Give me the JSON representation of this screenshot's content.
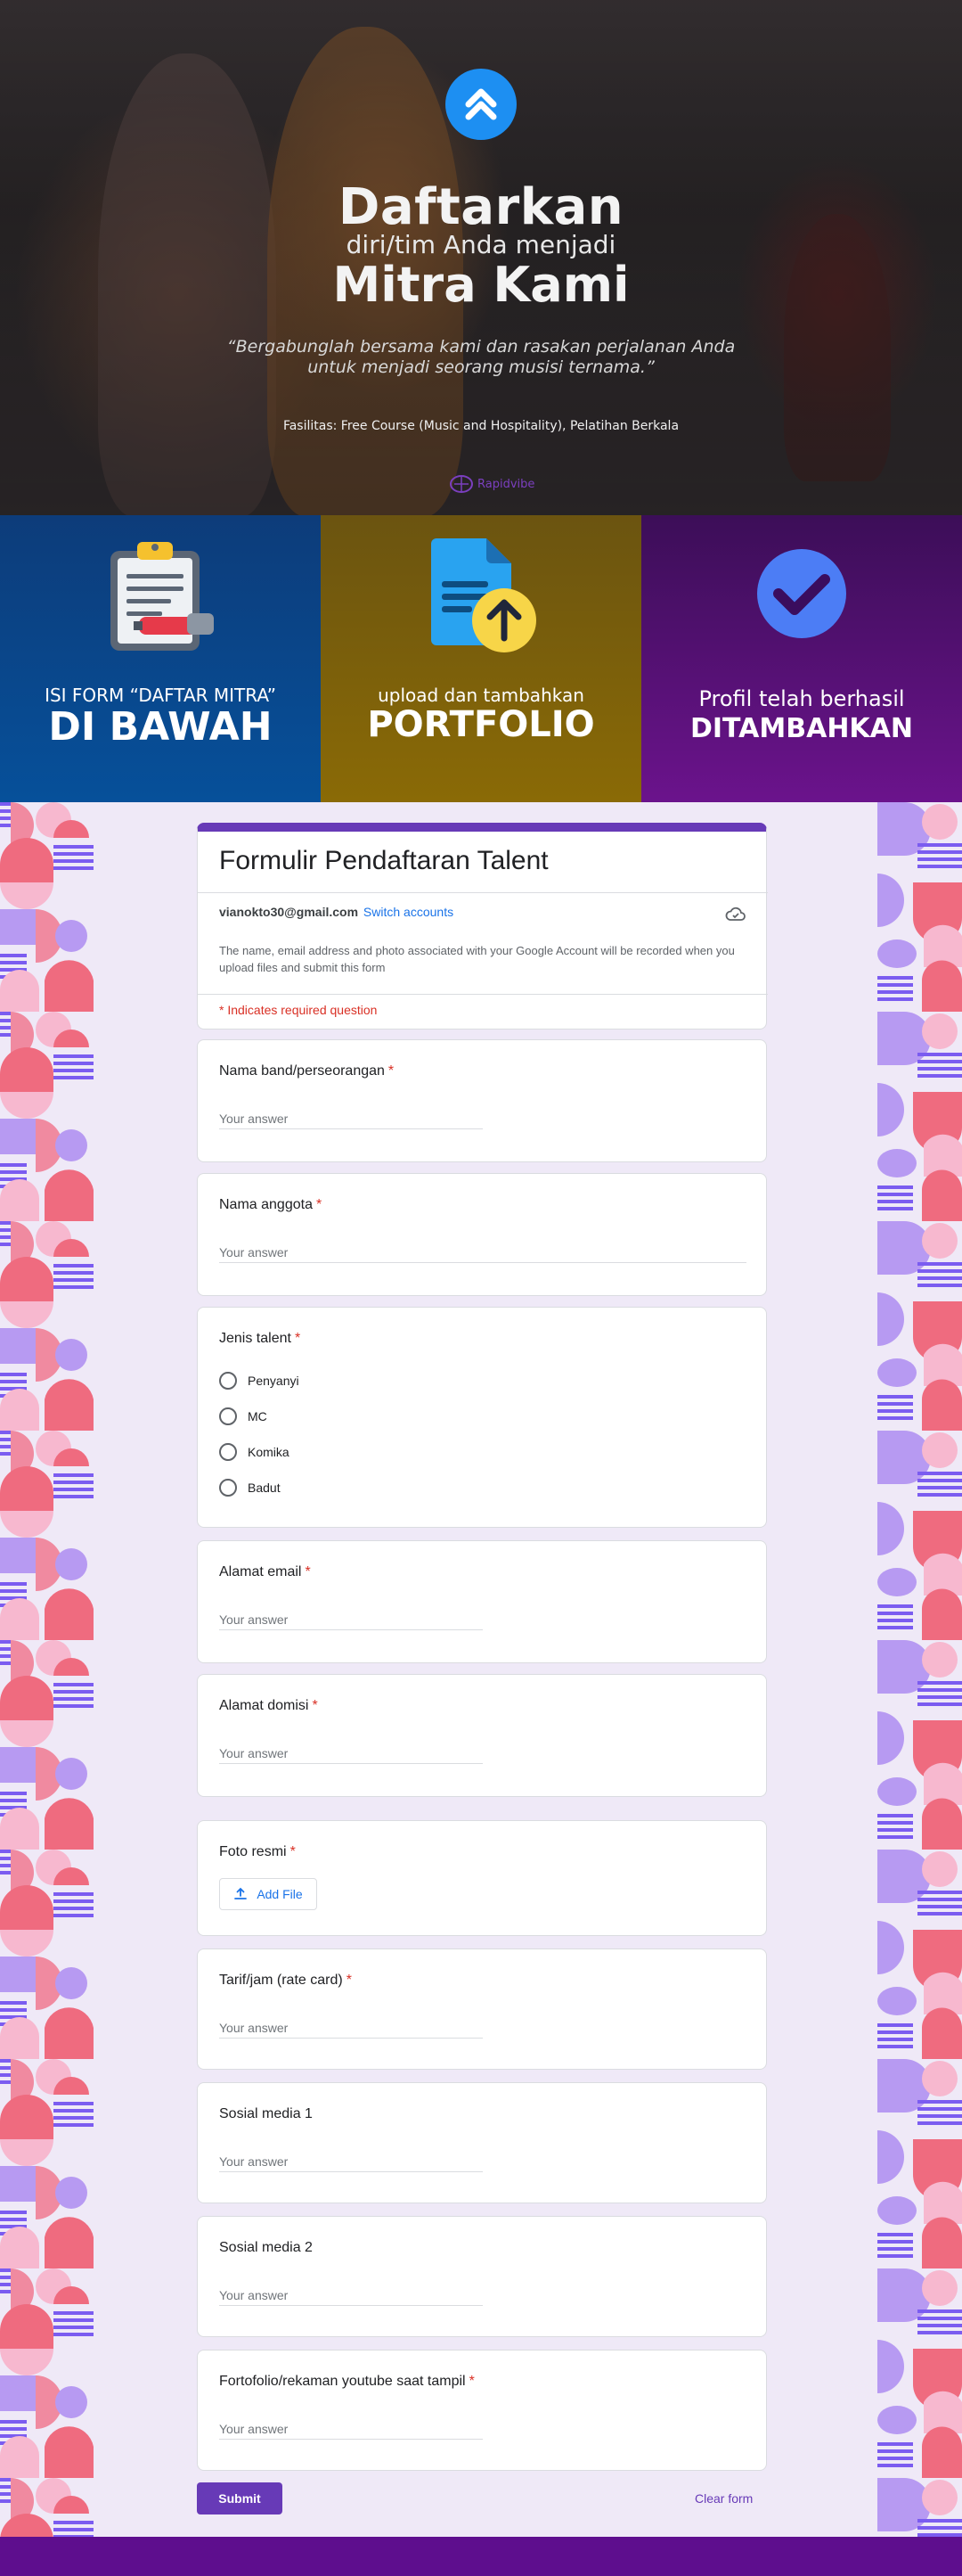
{
  "hero": {
    "title": "Daftarkan",
    "subtitle": "diri/tim Anda menjadi",
    "title2": "Mitra Kami",
    "quote": "“Bergabunglah bersama kami dan rasakan perjalanan Anda untuk menjadi seorang musisi ternama.”",
    "facilities": "Fasilitas: Free Course (Music and Hospitality), Pelatihan Berkala",
    "watermark": "Rapidvibe",
    "logo_color": "#1d8ff2"
  },
  "steps": [
    {
      "small": "ISI FORM “DAFTAR MITRA”",
      "big": "DI BAWAH",
      "icon": "clipboard-icon",
      "color": "#06509a"
    },
    {
      "small": "upload dan tambahkan",
      "big": "PORTFOLIO",
      "icon": "file-upload-icon",
      "color": "#8a6a06"
    },
    {
      "small": "Profil telah berhasil",
      "big": "DITAMBAHKAN",
      "icon": "check-circle-icon",
      "color": "#6b138c"
    }
  ],
  "form": {
    "title": "Formulir Pendaftaran Talent",
    "email": "vianokto30@gmail.com",
    "switch_accounts": "Switch accounts",
    "notice": "The name, email address and photo associated with your Google Account will be recorded when you upload files and submit this form",
    "required_note": "* Indicates required question",
    "accent": "#673ab7",
    "placeholder": "Your answer",
    "required_mark": "*",
    "questions": [
      {
        "label": "Nama band/perseorangan",
        "required": true
      },
      {
        "label": "Nama anggota",
        "required": true
      },
      {
        "label": "Jenis talent",
        "required": true,
        "options": [
          "Penyanyi",
          "MC",
          "Komika",
          "Badut"
        ]
      },
      {
        "label": "Alamat email",
        "required": true
      },
      {
        "label": "Alamat domisi",
        "required": true
      },
      {
        "label": "Foto resmi",
        "required": true,
        "button": "Add File"
      },
      {
        "label": "Tarif/jam (rate card)",
        "required": true
      },
      {
        "label": "Sosial media 1",
        "required": false
      },
      {
        "label": "Sosial media 2",
        "required": false
      },
      {
        "label": "Fortofolio/rekaman youtube saat tampil",
        "required": true
      }
    ],
    "submit": "Submit",
    "clear": "Clear form"
  }
}
